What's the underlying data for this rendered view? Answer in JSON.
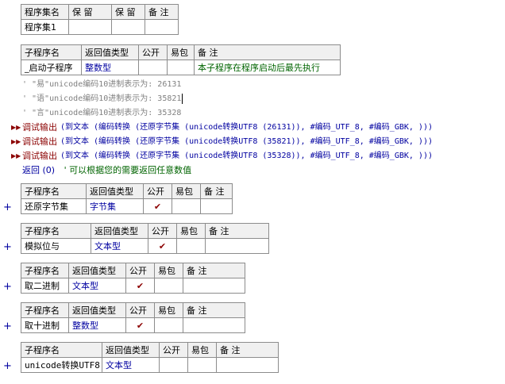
{
  "set_table": {
    "headers": [
      "程序集名",
      "保 留",
      "保 留",
      "备 注"
    ],
    "row": [
      "程序集1",
      "",
      "",
      ""
    ]
  },
  "startup_table": {
    "headers": [
      "子程序名",
      "返回值类型",
      "公开",
      "易包",
      "备 注"
    ],
    "row": {
      "name": "_启动子程序",
      "type": "整数型",
      "public": "",
      "easypkg": "",
      "remark": "本子程序在程序启动后最先执行"
    }
  },
  "code": {
    "comments": [
      "' \"易\"unicode编码10进制表示为: 26131",
      "' \"语\"unicode编码10进制表示为: 35821",
      "' \"言\"unicode编码10进制表示为: 35328"
    ],
    "debug_lines": [
      {
        "func": "调试输出",
        "args": " (到文本 (编码转换 (还原字节集 (unicode转换UTF8 (26131)), #编码_UTF_8, #编码_GBK, )))"
      },
      {
        "func": "调试输出",
        "args": " (到文本 (编码转换 (还原字节集 (unicode转换UTF8 (35821)), #编码_UTF_8, #编码_GBK, )))"
      },
      {
        "func": "调试输出",
        "args": " (到文本 (编码转换 (还原字节集 (unicode转换UTF8 (35328)), #编码_UTF_8, #编码_GBK, )))"
      }
    ],
    "return_stmt": "返回 (0)",
    "return_comment": "' 可以根据您的需要返回任意数值"
  },
  "sub_tables": [
    {
      "headers": [
        "子程序名",
        "返回值类型",
        "公开",
        "易包",
        "备 注"
      ],
      "name": "还原字节集",
      "type": "字节集",
      "public": "✔",
      "easypkg": "",
      "remark": ""
    },
    {
      "headers": [
        "子程序名",
        "返回值类型",
        "公开",
        "易包",
        "备 注"
      ],
      "name": "模拟位与",
      "type": "文本型",
      "public": "✔",
      "easypkg": "",
      "remark": ""
    },
    {
      "headers": [
        "子程序名",
        "返回值类型",
        "公开",
        "易包",
        "备 注"
      ],
      "name": "取二进制",
      "type": "文本型",
      "public": "✔",
      "easypkg": "",
      "remark": ""
    },
    {
      "headers": [
        "子程序名",
        "返回值类型",
        "公开",
        "易包",
        "备 注"
      ],
      "name": "取十进制",
      "type": "整数型",
      "public": "✔",
      "easypkg": "",
      "remark": ""
    },
    {
      "headers": [
        "子程序名",
        "返回值类型",
        "公开",
        "易包",
        "备 注"
      ],
      "name": "unicode转换UTF8",
      "type": "文本型",
      "public": "",
      "easypkg": "",
      "remark": ""
    }
  ],
  "icons": {
    "expand": "plus-icon",
    "debug": "arrow-icon",
    "check": "check-icon"
  },
  "colors": {
    "keyword": "#0000a0",
    "remark": "#006400",
    "debug": "#8b0000",
    "comment": "#808080"
  }
}
